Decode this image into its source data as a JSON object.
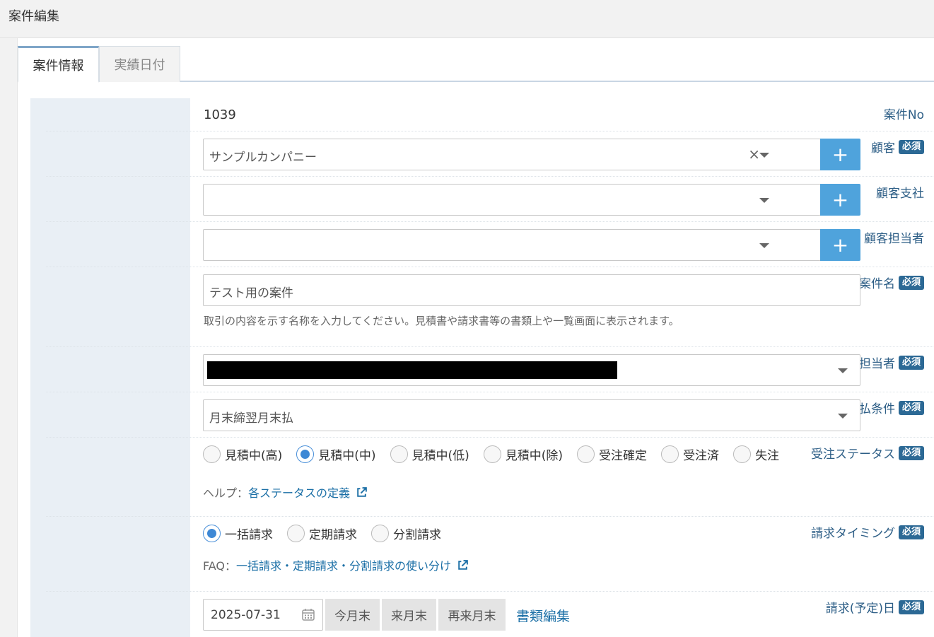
{
  "page": {
    "title": "案件編集"
  },
  "tabs": [
    {
      "label": "案件情報",
      "active": true
    },
    {
      "label": "実績日付",
      "active": false
    }
  ],
  "required_badge": "必須",
  "fields": {
    "case_no": {
      "label": "案件No",
      "value": "1039"
    },
    "customer": {
      "label": "顧客",
      "value": "サンプルカンパニー",
      "clear": "×",
      "add": "+"
    },
    "customer_branch": {
      "label": "顧客支社",
      "value": "",
      "add": "+"
    },
    "customer_contact": {
      "label": "顧客担当者",
      "value": "",
      "add": "+"
    },
    "case_name": {
      "label": "案件名",
      "value": "テスト用の案件",
      "help": "取引の内容を示す名称を入力してください。見積書や請求書等の書類上や一覧画面に表示されます。"
    },
    "assignee": {
      "label": "担当者",
      "value": ""
    },
    "payment_terms": {
      "label": "支払条件",
      "value": "月末締翌月末払"
    },
    "order_status": {
      "label": "受注ステータス",
      "options": [
        "見積中(高)",
        "見積中(中)",
        "見積中(低)",
        "見積中(除)",
        "受注確定",
        "受注済",
        "失注"
      ],
      "selected": 1,
      "help_prefix": "ヘルプ：",
      "help_link": "各ステータスの定義"
    },
    "billing_timing": {
      "label": "請求タイミング",
      "options": [
        "一括請求",
        "定期請求",
        "分割請求"
      ],
      "selected": 0,
      "faq_prefix": "FAQ：",
      "faq_link": "一括請求・定期請求・分割請求の使い分け"
    },
    "billing_date": {
      "label": "請求(予定)日",
      "value": "2025-07-31",
      "buttons": [
        "今月末",
        "来月末",
        "再来月末"
      ],
      "doc_link": "書類編集"
    }
  }
}
